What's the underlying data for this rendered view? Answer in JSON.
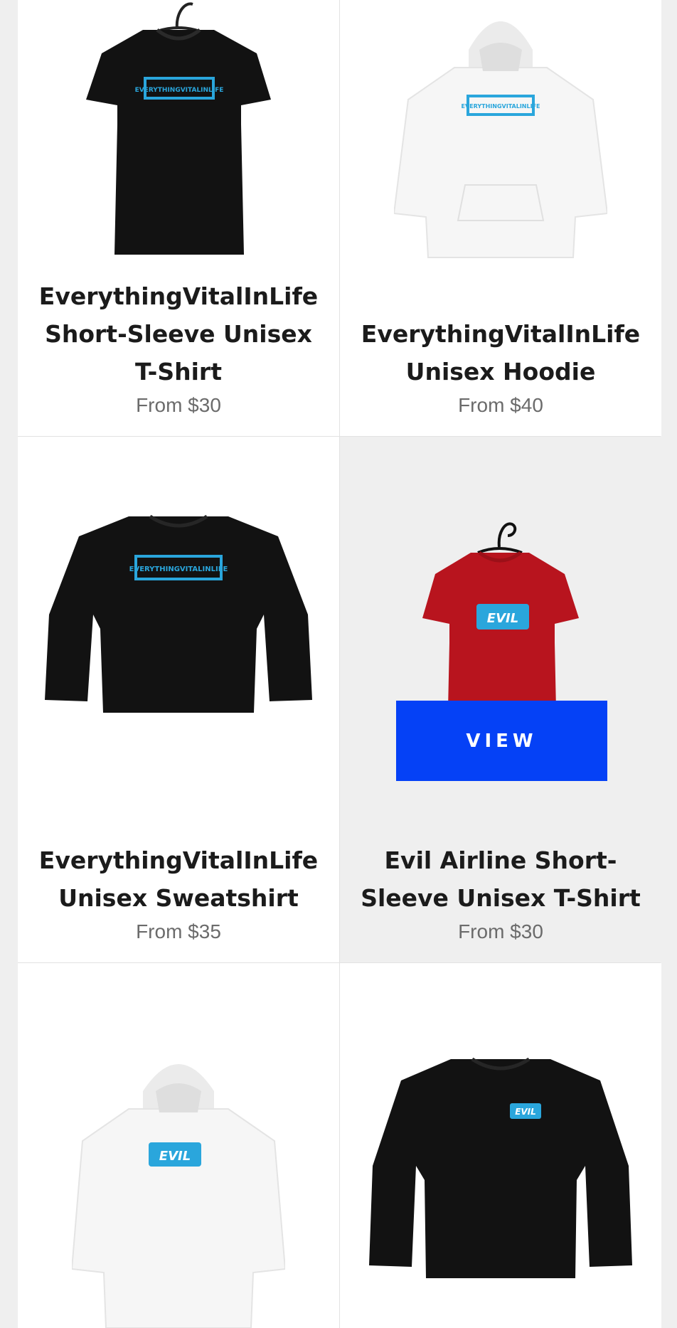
{
  "products": [
    {
      "title": "EverythingVitalInLife Short-Sleeve Unisex T-Shirt",
      "price": "From $30",
      "logo_text": "EVERYTHINGVITALINLIFE",
      "garment": "tshirt",
      "color": "#121212",
      "logo_color": "#2aa6dc"
    },
    {
      "title": "EverythingVitalInLife Unisex Hoodie",
      "price": "From $40",
      "logo_text": "EVERYTHINGVITALINLIFE",
      "garment": "hoodie",
      "color": "#f6f6f6",
      "logo_color": "#2aa6dc"
    },
    {
      "title": "EverythingVitalInLife Unisex Sweatshirt",
      "price": "From $35",
      "logo_text": "EVERYTHINGVITALINLIFE",
      "garment": "sweatshirt",
      "color": "#121212",
      "logo_color": "#2aa6dc"
    },
    {
      "title": "Evil Airline Short-Sleeve Unisex T-Shirt",
      "price": "From $30",
      "logo_text": "EVIL",
      "garment": "tshirt",
      "color": "#b8141e",
      "logo_color": "#2aa6dc",
      "button": "VIEW"
    },
    {
      "logo_text": "EVIL",
      "garment": "hoodie",
      "color": "#f6f6f6",
      "logo_color": "#2aa6dc"
    },
    {
      "logo_text": "EVIL",
      "garment": "sweatshirt",
      "color": "#121212",
      "logo_color": "#2aa6dc"
    }
  ],
  "colors": {
    "view_button": "#0541f6",
    "page_bg": "#efefef"
  }
}
